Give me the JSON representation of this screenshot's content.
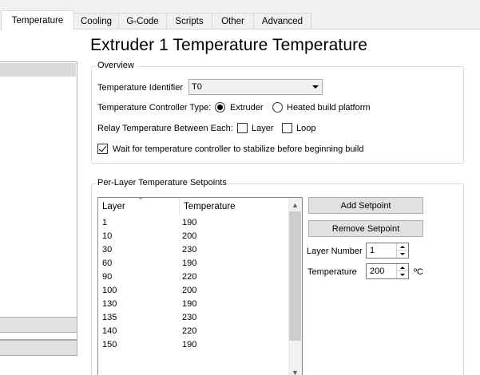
{
  "tabs": [
    {
      "label": "Temperature",
      "active": true
    },
    {
      "label": "Cooling"
    },
    {
      "label": "G-Code"
    },
    {
      "label": "Scripts"
    },
    {
      "label": "Other"
    },
    {
      "label": "Advanced"
    }
  ],
  "title": "Extruder 1 Temperature Temperature",
  "overview": {
    "group_label": "Overview",
    "identifier_label": "Temperature Identifier",
    "identifier_value": "T0",
    "controller_type_label": "Temperature Controller Type:",
    "controller_options": [
      "Extruder",
      "Heated build platform"
    ],
    "controller_selected": "Extruder",
    "relay_label": "Relay Temperature Between Each:",
    "relay_layer_label": "Layer",
    "relay_layer_checked": false,
    "relay_loop_label": "Loop",
    "relay_loop_checked": false,
    "wait_label": "Wait for temperature controller to stabilize before beginning build",
    "wait_checked": true
  },
  "setpoints": {
    "group_label": "Per-Layer Temperature Setpoints",
    "columns": [
      "Layer",
      "Temperature"
    ],
    "rows": [
      [
        "1",
        "190"
      ],
      [
        "10",
        "200"
      ],
      [
        "30",
        "230"
      ],
      [
        "60",
        "190"
      ],
      [
        "90",
        "220"
      ],
      [
        "100",
        "200"
      ],
      [
        "130",
        "190"
      ],
      [
        "135",
        "230"
      ],
      [
        "140",
        "220"
      ],
      [
        "150",
        "190"
      ]
    ],
    "add_button": "Add Setpoint",
    "remove_button": "Remove Setpoint",
    "layer_number_label": "Layer Number",
    "layer_number_value": "1",
    "temperature_label": "Temperature",
    "temperature_value": "200",
    "temperature_unit": "ºC"
  },
  "icons": {
    "scroll_up": "chevron-up-icon",
    "scroll_down": "chevron-down-icon",
    "dropdown": "dropdown-arrow-icon",
    "sort": "sort-indicator-icon"
  }
}
